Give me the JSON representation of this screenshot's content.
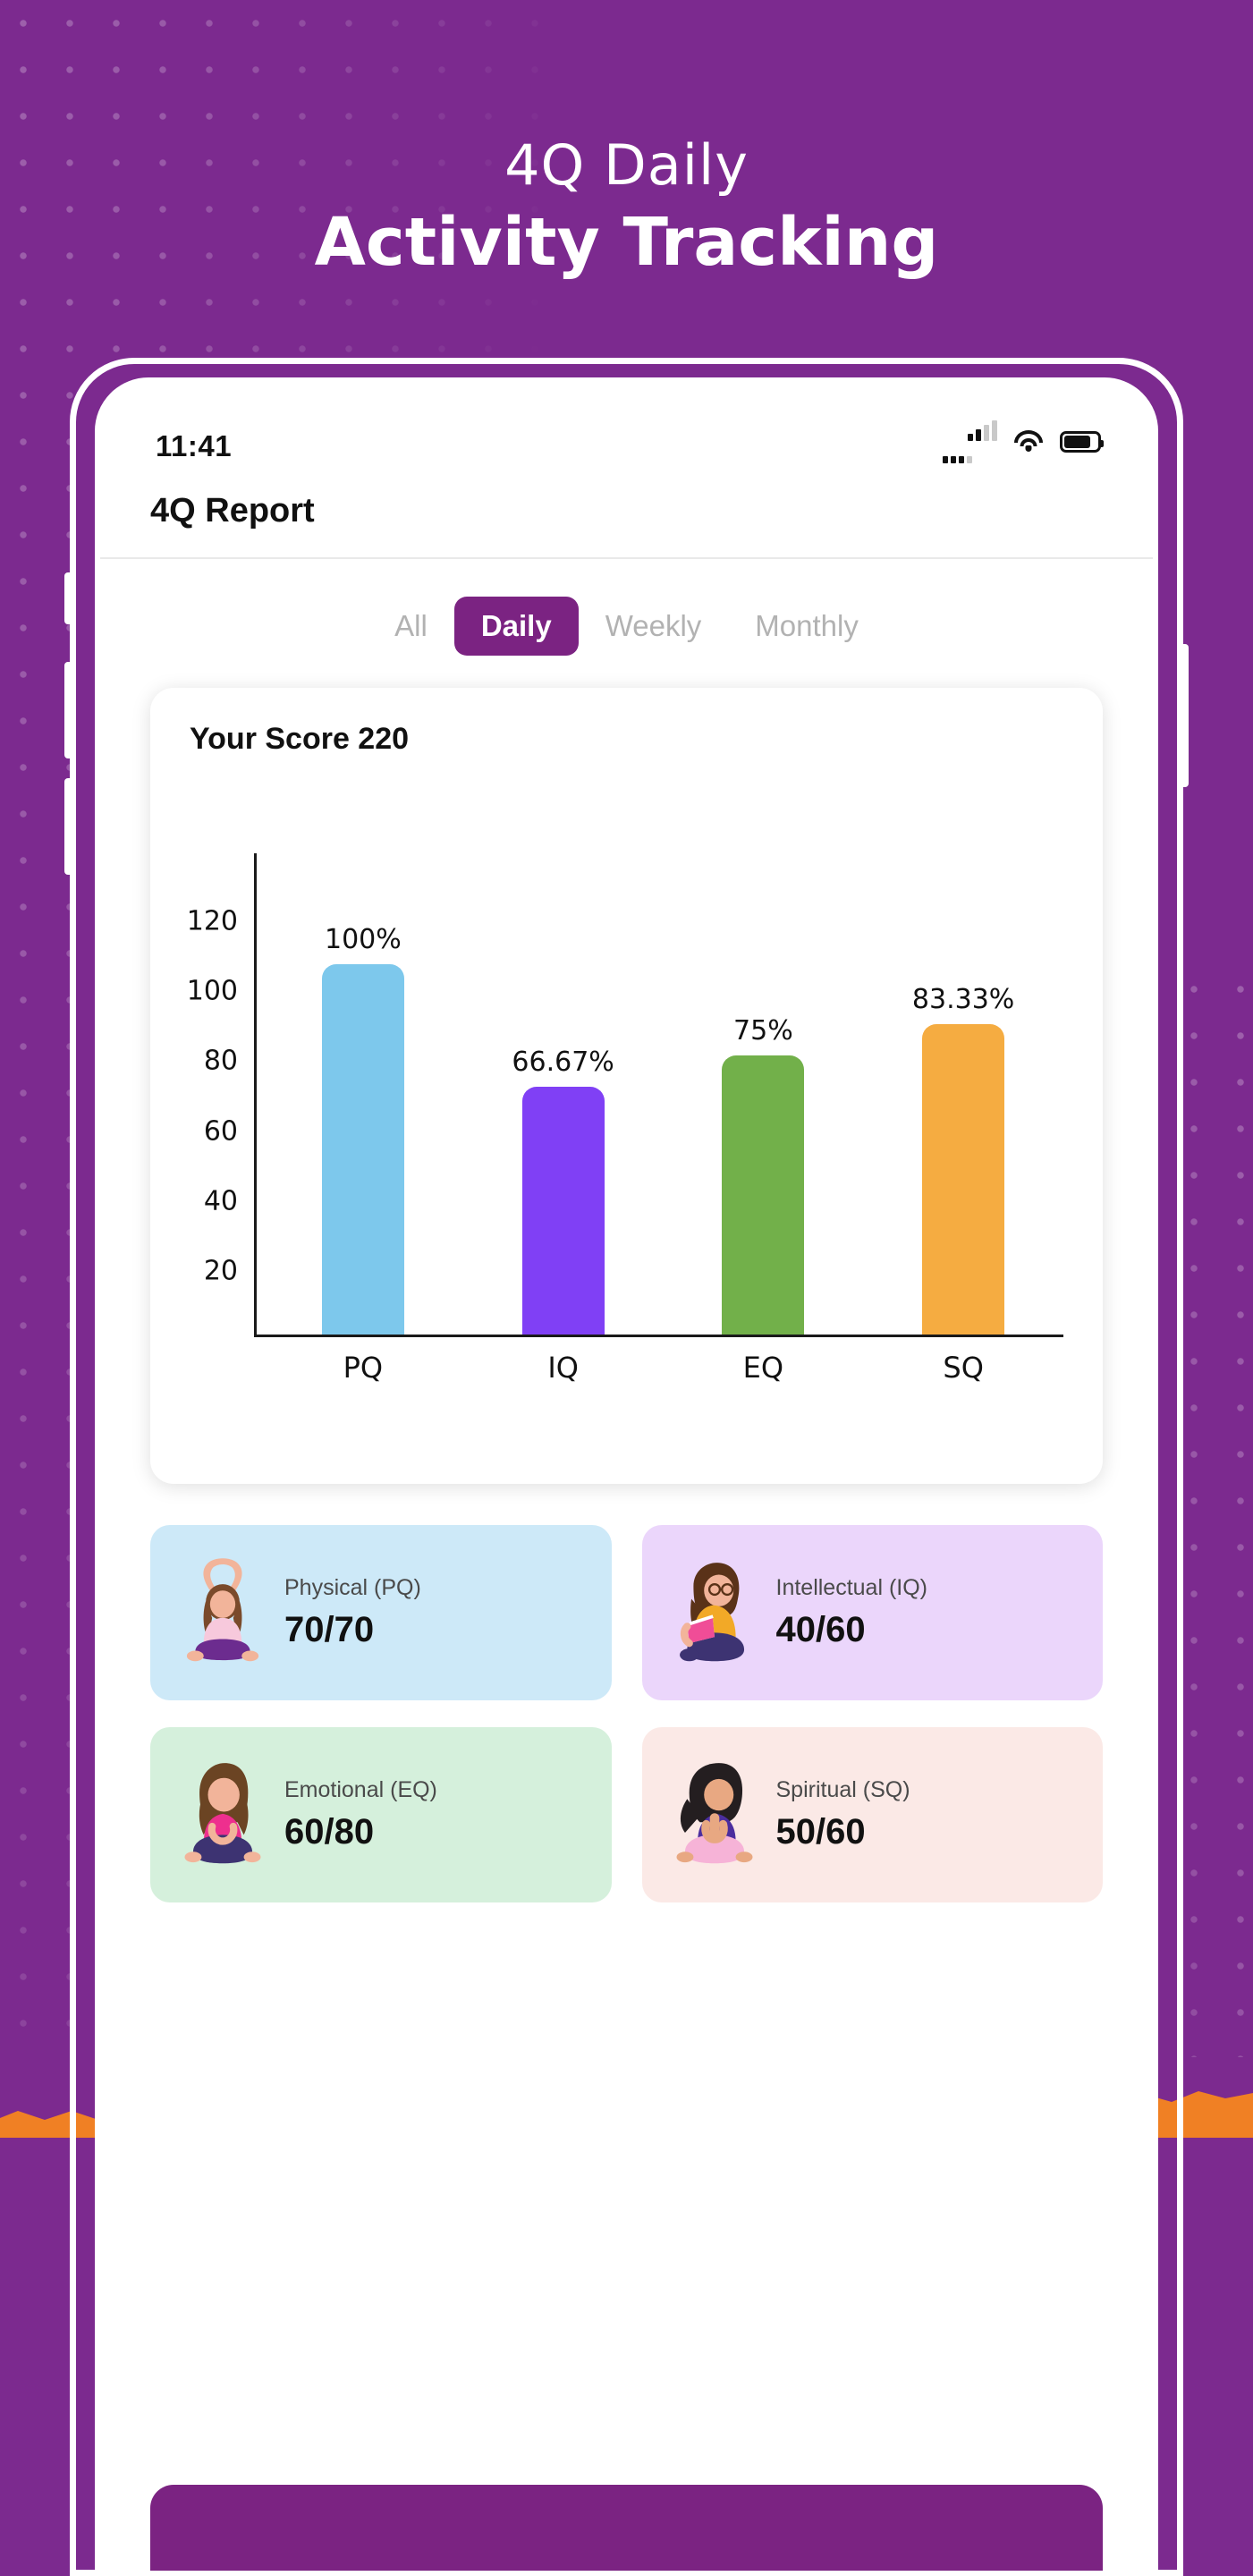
{
  "promo": {
    "headline_line1": "4Q Daily",
    "headline_line2": "Activity Tracking",
    "bg_color": "#7C2A8F",
    "accent_color": "#F08024"
  },
  "status_bar": {
    "time": "11:41",
    "signal_icon": "cellular-signal-icon",
    "wifi_icon": "wifi-icon",
    "battery_icon": "battery-icon"
  },
  "app": {
    "title": "4Q Report"
  },
  "tabs": [
    {
      "label": "All",
      "active": false
    },
    {
      "label": "Daily",
      "active": true
    },
    {
      "label": "Weekly",
      "active": false
    },
    {
      "label": "Monthly",
      "active": false
    }
  ],
  "chart_card": {
    "title": "Your Score 220"
  },
  "chart_data": {
    "type": "bar",
    "title": "Your Score 220",
    "categories": [
      "PQ",
      "IQ",
      "EQ",
      "SQ"
    ],
    "values": [
      100,
      66.67,
      75,
      83.33
    ],
    "data_labels": [
      "100%",
      "66.67%",
      "75%",
      "83.33%"
    ],
    "colors": [
      "#7DC8EC",
      "#8040F5",
      "#72B04A",
      "#F5AC41"
    ],
    "ylim": [
      0,
      130
    ],
    "yticks": [
      20,
      40,
      60,
      80,
      100,
      120
    ],
    "ytick_labels": [
      "20",
      "40",
      "60",
      "80",
      "100",
      "120"
    ],
    "xlabel": "",
    "ylabel": "",
    "grid": false,
    "legend": false
  },
  "stat_cards": [
    {
      "label": "Physical (PQ)",
      "value": "70/70",
      "bg": "#CDE9F8",
      "figure": "yoga-arms-up-icon"
    },
    {
      "label": "Intellectual (IQ)",
      "value": "40/60",
      "bg": "#EBD6FB",
      "figure": "reading-book-icon"
    },
    {
      "label": "Emotional (EQ)",
      "value": "60/80",
      "bg": "#D5F0DC",
      "figure": "sitting-calm-icon"
    },
    {
      "label": "Spiritual (SQ)",
      "value": "50/60",
      "bg": "#FBE9E6",
      "figure": "meditating-namaste-icon"
    }
  ],
  "bottom_button": {
    "label": ""
  }
}
